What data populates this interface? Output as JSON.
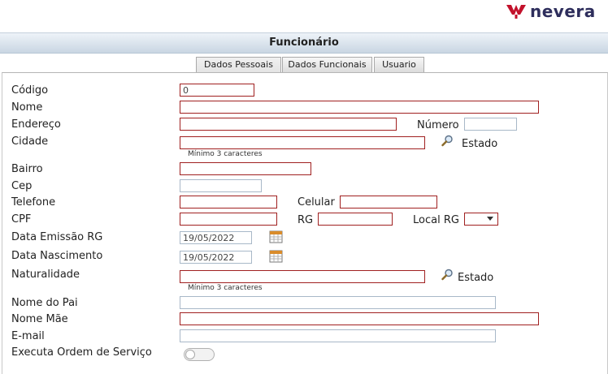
{
  "brand": {
    "name": "nevera",
    "accent": "#c2112b"
  },
  "header": {
    "title": "Funcionário"
  },
  "tabs": [
    {
      "label": "Dados Pessoais",
      "active": true
    },
    {
      "label": "Dados Funcionais",
      "active": false
    },
    {
      "label": "Usuario",
      "active": false
    }
  ],
  "form": {
    "codigo": {
      "label": "Código",
      "value": "0"
    },
    "nome": {
      "label": "Nome",
      "value": ""
    },
    "endereco": {
      "label": "Endereço",
      "value": ""
    },
    "numero": {
      "label": "Número",
      "value": ""
    },
    "cidade": {
      "label": "Cidade",
      "value": "",
      "hint": "Mínimo 3 caracteres",
      "estado_label": "Estado"
    },
    "bairro": {
      "label": "Bairro",
      "value": ""
    },
    "cep": {
      "label": "Cep",
      "value": ""
    },
    "telefone": {
      "label": "Telefone",
      "value": ""
    },
    "celular": {
      "label": "Celular",
      "value": ""
    },
    "cpf": {
      "label": "CPF",
      "value": ""
    },
    "rg": {
      "label": "RG",
      "value": ""
    },
    "local_rg": {
      "label": "Local RG",
      "value": ""
    },
    "data_emissao_rg": {
      "label": "Data Emissão RG",
      "value": "19/05/2022"
    },
    "data_nascimento": {
      "label": "Data Nascimento",
      "value": "19/05/2022"
    },
    "naturalidade": {
      "label": "Naturalidade",
      "value": "",
      "hint": "Mínimo 3 caracteres",
      "estado_label": "Estado"
    },
    "nome_pai": {
      "label": "Nome do Pai",
      "value": ""
    },
    "nome_mae": {
      "label": "Nome Mãe",
      "value": ""
    },
    "email": {
      "label": "E-mail",
      "value": ""
    },
    "executa_os": {
      "label": "Executa Ordem de Serviço",
      "on": false
    }
  },
  "icons": {
    "logo": "nevera-logo-icon",
    "search": "magnifier-icon",
    "calendar": "calendar-icon"
  }
}
